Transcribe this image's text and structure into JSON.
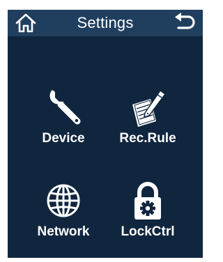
{
  "header": {
    "title": "Settings",
    "home_icon": "home-icon",
    "back_icon": "back-arrow-icon"
  },
  "menu": [
    {
      "label": "Device",
      "icon": "wrench-icon"
    },
    {
      "label": "Rec.Rule",
      "icon": "document-pen-icon"
    },
    {
      "label": "Network",
      "icon": "globe-icon"
    },
    {
      "label": "LockCtrl",
      "icon": "padlock-gear-icon"
    }
  ],
  "colors": {
    "background": "#10263e",
    "header": "#203f5e",
    "text": "#ffffff"
  }
}
